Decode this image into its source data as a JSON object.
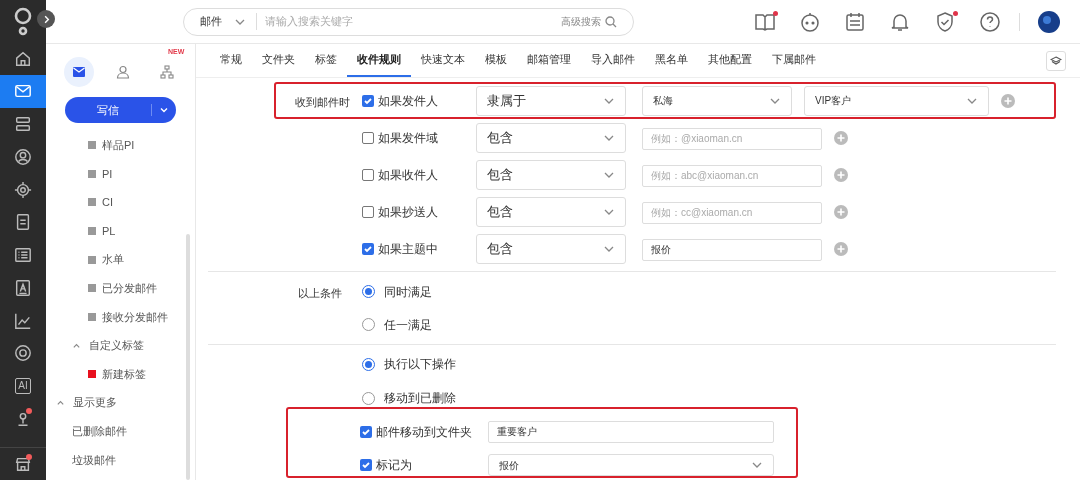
{
  "rail": {
    "items": [
      {
        "kind": "home",
        "selected": false
      },
      {
        "kind": "mail",
        "selected": true
      },
      {
        "kind": "stack",
        "selected": false
      },
      {
        "kind": "contact",
        "selected": false
      },
      {
        "kind": "target",
        "selected": false
      },
      {
        "kind": "doc",
        "selected": false
      },
      {
        "kind": "list",
        "selected": false
      },
      {
        "kind": "letter",
        "selected": false
      },
      {
        "kind": "chart",
        "selected": false
      },
      {
        "kind": "ring",
        "selected": false
      },
      {
        "kind": "ai",
        "text": "AI",
        "selected": false
      },
      {
        "kind": "pin",
        "badge": true,
        "selected": false
      },
      {
        "kind": "shop",
        "badge": true,
        "selected": false
      }
    ]
  },
  "search": {
    "scope": "邮件",
    "placeholder": "请输入搜索关键字",
    "advanced": "高级搜索"
  },
  "toolbar": [
    {
      "kind": "book",
      "badge": true
    },
    {
      "kind": "bot",
      "badge": false
    },
    {
      "kind": "calendar",
      "badge": false
    },
    {
      "kind": "bell",
      "badge": false
    },
    {
      "kind": "shield",
      "badge": true
    },
    {
      "kind": "help",
      "badge": false
    }
  ],
  "sidebar": {
    "modes": [
      {
        "kind": "mail",
        "selected": true
      },
      {
        "kind": "person",
        "selected": false
      },
      {
        "kind": "org",
        "selected": false,
        "badge": "NEW"
      }
    ],
    "compose": "写信",
    "items": [
      {
        "kind": "tag",
        "label": "样品PI",
        "color": "#999999"
      },
      {
        "kind": "tag",
        "label": "PI",
        "color": "#999999"
      },
      {
        "kind": "tag",
        "label": "CI",
        "color": "#999999"
      },
      {
        "kind": "tag",
        "label": "PL",
        "color": "#999999"
      },
      {
        "kind": "tag",
        "label": "水单",
        "color": "#999999"
      },
      {
        "kind": "tag",
        "label": "已分发邮件",
        "color": "#999999"
      },
      {
        "kind": "tag",
        "label": "接收分发邮件",
        "color": "#999999"
      },
      {
        "kind": "group",
        "label": "自定义标签",
        "expanded": true,
        "children": [
          {
            "kind": "tag",
            "label": "新建标签",
            "color": "#e8101e"
          }
        ]
      },
      {
        "kind": "more",
        "label": "显示更多",
        "expanded": true
      },
      {
        "kind": "folder",
        "label": "已删除邮件"
      },
      {
        "kind": "folder",
        "label": "垃圾邮件"
      }
    ]
  },
  "tabs": [
    {
      "label": "常规",
      "selected": false
    },
    {
      "label": "文件夹",
      "selected": false
    },
    {
      "label": "标签",
      "selected": false
    },
    {
      "label": "收件规则",
      "selected": true
    },
    {
      "label": "快速文本",
      "selected": false
    },
    {
      "label": "模板",
      "selected": false
    },
    {
      "label": "邮箱管理",
      "selected": false
    },
    {
      "label": "导入邮件",
      "selected": false
    },
    {
      "label": "黑名单",
      "selected": false
    },
    {
      "label": "其他配置",
      "selected": false
    },
    {
      "label": "下属邮件",
      "selected": false
    }
  ],
  "conditions": {
    "label": "收到邮件时",
    "rows": [
      {
        "checked": true,
        "label": "如果发件人",
        "operator": "隶属于",
        "value": {
          "kind": "select",
          "text": "私海"
        },
        "extra": {
          "kind": "select",
          "text": "VIP客户"
        },
        "highlighted": true
      },
      {
        "checked": false,
        "label": "如果发件域",
        "operator": "包含",
        "value": {
          "kind": "input",
          "placeholder": "例如：@xiaoman.cn"
        },
        "highlighted": false
      },
      {
        "checked": false,
        "label": "如果收件人",
        "operator": "包含",
        "value": {
          "kind": "input",
          "placeholder": "例如：abc@xiaoman.cn"
        },
        "highlighted": false
      },
      {
        "checked": false,
        "label": "如果抄送人",
        "operator": "包含",
        "value": {
          "kind": "input",
          "placeholder": "例如：cc@xiaoman.cn"
        },
        "highlighted": false
      },
      {
        "checked": true,
        "label": "如果主题中",
        "operator": "包含",
        "value": {
          "kind": "input",
          "text": "报价"
        },
        "highlighted": false
      }
    ]
  },
  "match": {
    "label": "以上条件",
    "options": [
      {
        "label": "同时满足",
        "selected": true
      },
      {
        "label": "任一满足",
        "selected": false
      }
    ]
  },
  "actions": {
    "options": [
      {
        "label": "执行以下操作",
        "selected": true
      },
      {
        "label": "移动到已删除",
        "selected": false
      }
    ],
    "highlighted": true,
    "items": [
      {
        "checked": true,
        "label": "邮件移动到文件夹",
        "field": {
          "kind": "input",
          "text": "重要客户"
        }
      },
      {
        "checked": true,
        "label": "标记为",
        "field": {
          "kind": "select",
          "text": "报价"
        }
      }
    ]
  }
}
